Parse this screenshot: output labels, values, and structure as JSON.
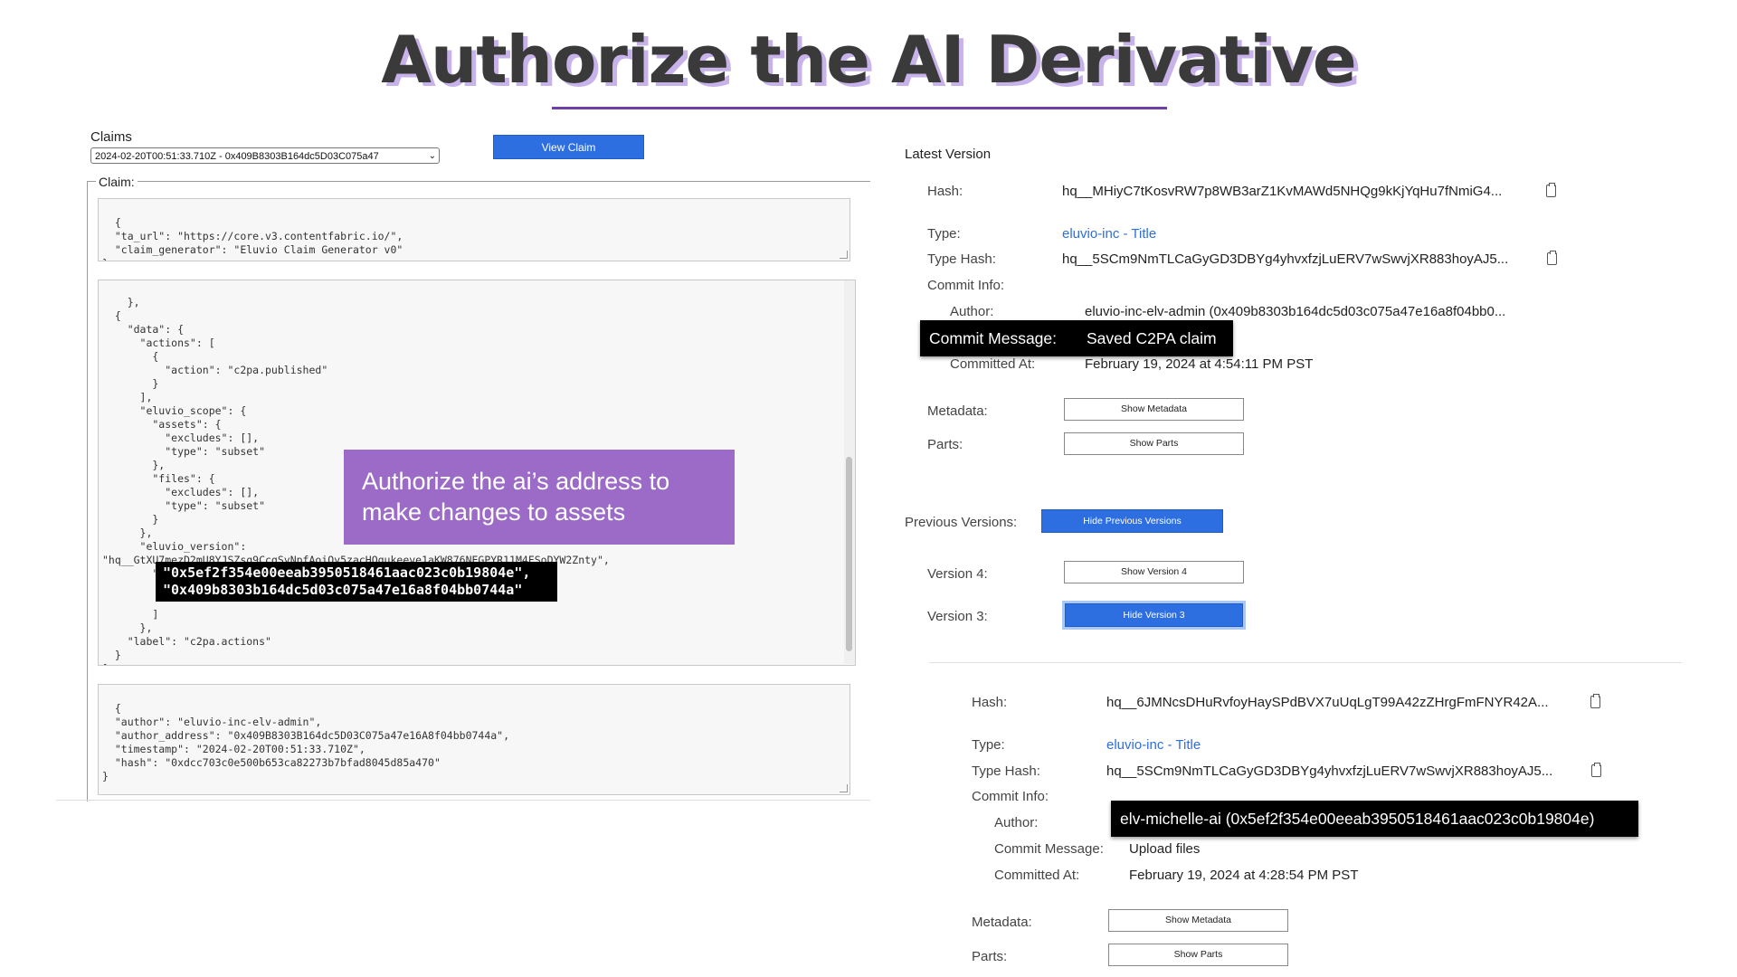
{
  "title": "Authorize the AI Derivative",
  "left": {
    "claims_label": "Claims",
    "claims_select_value": "2024-02-20T00:51:33.710Z - 0x409B8303B164dc5D03C075a47",
    "view_claim_label": "View Claim",
    "claim_legend": "Claim:",
    "code1": "{\n  \"ta_url\": \"https://core.v3.contentfabric.io/\",\n  \"claim_generator\": \"Eluvio Claim Generator v0\"\n}",
    "code2": "  },\n  {\n    \"data\": {\n      \"actions\": [\n        {\n          \"action\": \"c2pa.published\"\n        }\n      ],\n      \"eluvio_scope\": {\n        \"assets\": {\n          \"excludes\": [],\n          \"type\": \"subset\"\n        },\n        \"files\": {\n          \"excludes\": [],\n          \"type\": \"subset\"\n        }\n      },\n      \"eluvio_version\":\n\"hq__GtXU7mezD2mU8YJSZsq9CcqSyNpfAoiQy5zacHQqukeeve1aKW876NEGPYR11M4FSoDYW2Znty\",\n        \"exempts\": [\n\n\n        ]\n      },\n    \"label\": \"c2pa.actions\"\n  }\n]",
    "code3": "{\n  \"author\": \"eluvio-inc-elv-admin\",\n  \"author_address\": \"0x409B8303B164dc5D03C075a47e16A8f04bb0744a\",\n  \"timestamp\": \"2024-02-20T00:51:33.710Z\",\n  \"hash\": \"0xdcc703c0e500b653ca82273b7bfad8045d85a470\"\n}",
    "callout_text": "Authorize the ai’s address to make changes to assets",
    "highlight_addresses": "\"0x5ef2f354e00eeab3950518461aac023c0b19804e\",\n\"0x409b8303b164dc5d03c075a47e16a8f04bb0744a\""
  },
  "right": {
    "latest_version_label": "Latest Version",
    "hash_label": "Hash:",
    "hash_value": "hq__MHiyC7tKosvRW7p8WB3arZ1KvMAWd5NHQg9kKjYqHu7fNmiG4...",
    "type_label": "Type:",
    "type_value": "eluvio-inc - Title",
    "type_hash_label": "Type Hash:",
    "type_hash_value": "hq__5SCm9NmTLCaGyGD3DBYg4yhvxfzjLuERV7wSwvjXR883hoyAJ5...",
    "commit_info_label": "Commit Info:",
    "author_label": "Author:",
    "author_value": "eluvio-inc-elv-admin (0x409b8303b164dc5d03c075a47e16a8f04bb0...",
    "commit_message_label": "Commit Message:",
    "commit_message_value": "Saved C2PA claim",
    "committed_at_label": "Committed At:",
    "committed_at_value": "February 19, 2024 at 4:54:11 PM PST",
    "metadata_label": "Metadata:",
    "show_metadata_label": "Show Metadata",
    "parts_label": "Parts:",
    "show_parts_label": "Show Parts",
    "previous_versions_label": "Previous Versions:",
    "hide_previous_versions_label": "Hide Previous Versions",
    "version4_label": "Version 4:",
    "show_version4_label": "Show Version 4",
    "version3_label": "Version 3:",
    "hide_version3_label": "Hide Version 3",
    "v3": {
      "hash_label": "Hash:",
      "hash_value": "hq__6JMNcsDHuRvfoyHaySPdBVX7uUqLgT99A42zZHrgFmFNYR42A...",
      "type_label": "Type:",
      "type_value": "eluvio-inc - Title",
      "type_hash_label": "Type Hash:",
      "type_hash_value": "hq__5SCm9NmTLCaGyGD3DBYg4yhvxfzjLuERV7wSwvjXR883hoyAJ5...",
      "commit_info_label": "Commit Info:",
      "author_label": "Author:",
      "author_value": "elv-michelle-ai (0x5ef2f354e00eeab3950518461aac023c0b19804e)",
      "commit_message_label": "Commit Message:",
      "commit_message_value": "Upload files",
      "committed_at_label": "Committed At:",
      "committed_at_value": "February 19, 2024 at 4:28:54 PM PST",
      "metadata_label": "Metadata:",
      "show_metadata_label": "Show Metadata",
      "parts_label": "Parts:",
      "show_parts_label": "Show Parts"
    }
  },
  "colors": {
    "title_shadow": "#c7b3ea",
    "underline": "#6f3fa6",
    "callout_bg": "#9b6bc7",
    "primary_button": "#2d6ee0",
    "link": "#2d6ee0"
  }
}
